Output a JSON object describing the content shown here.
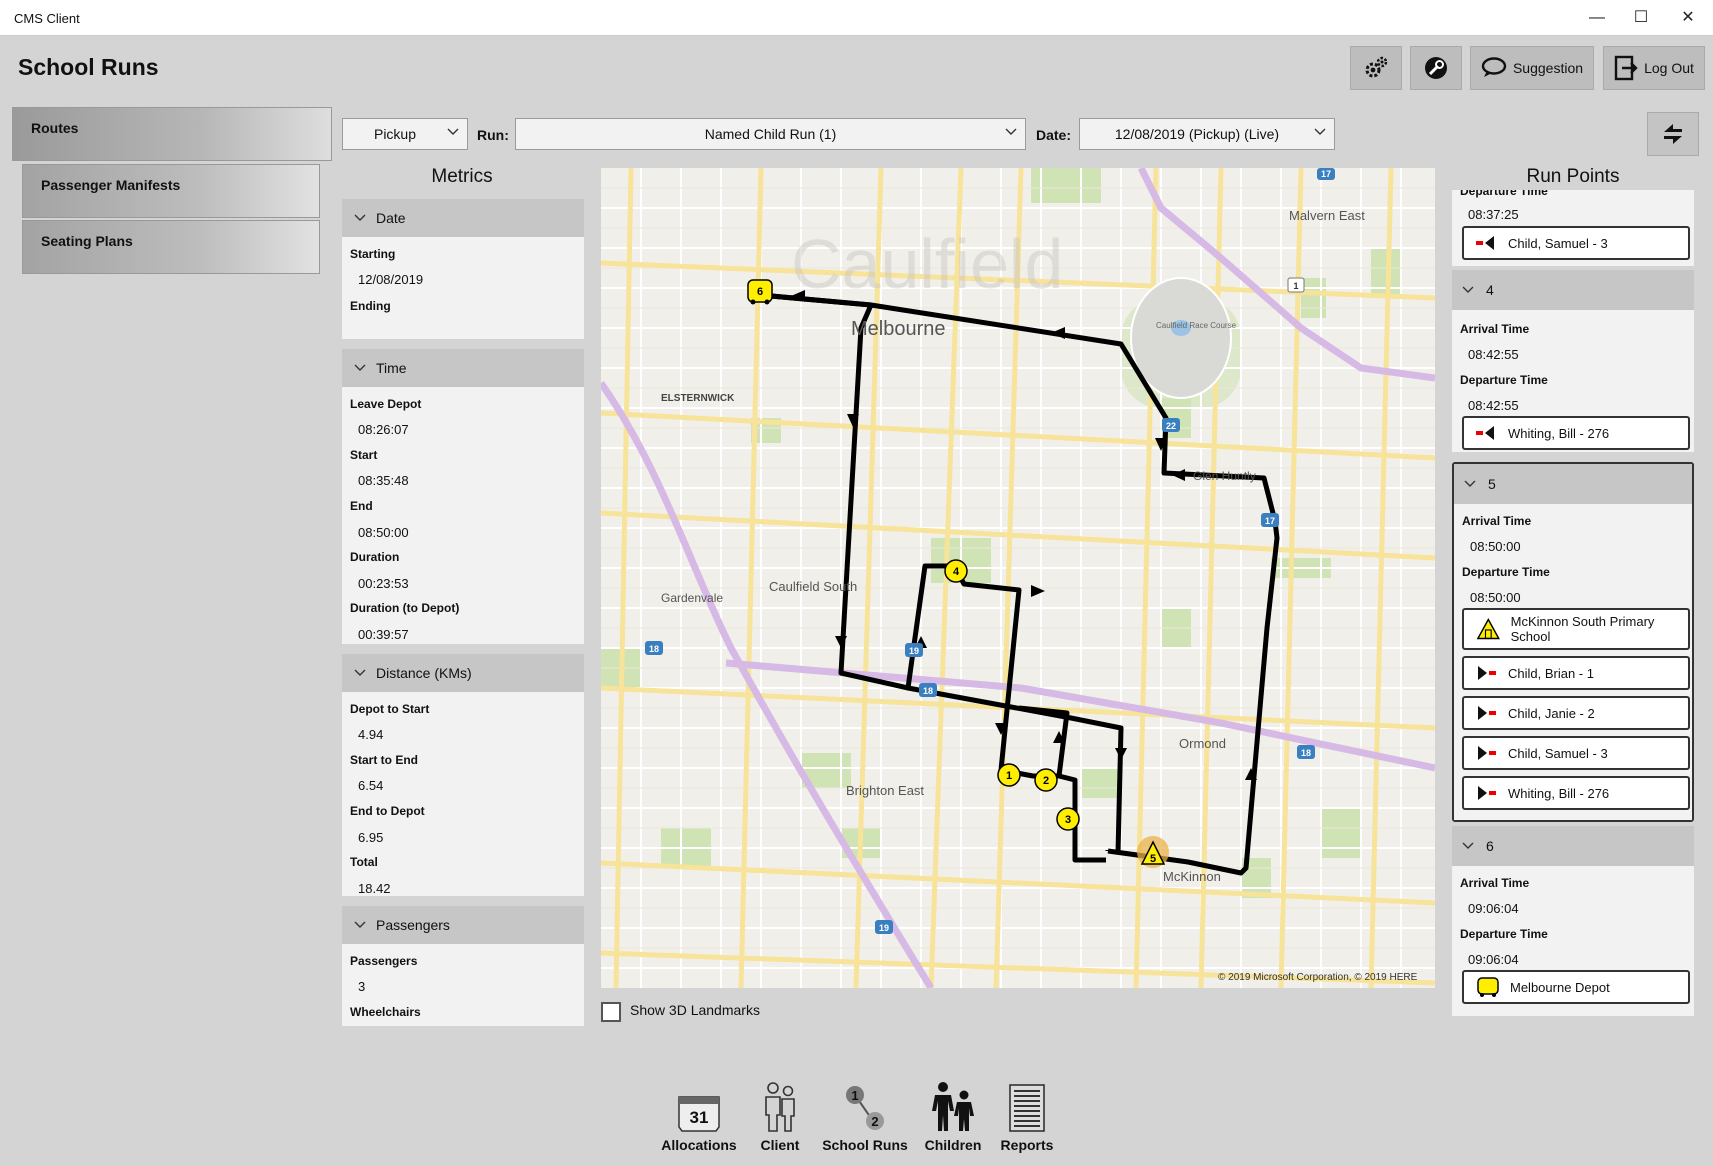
{
  "window": {
    "title": "CMS Client",
    "minimize": "—",
    "maximize": "☐",
    "close": "✕"
  },
  "app": {
    "title": "School Runs"
  },
  "toolbar": {
    "settings_icon": "gears-icon",
    "support_icon": "wrench-icon",
    "suggestion_label": "Suggestion",
    "logout_label": "Log Out"
  },
  "nav": {
    "items": [
      {
        "label": "Routes",
        "active": true
      },
      {
        "label": "Passenger Manifests",
        "active": false
      },
      {
        "label": "Seating Plans",
        "active": false
      }
    ]
  },
  "selectors": {
    "type": "Pickup",
    "run_label": "Run:",
    "run": "Named Child Run (1)",
    "date_label": "Date:",
    "date": "12/08/2019 (Pickup) (Live)"
  },
  "metrics": {
    "title": "Metrics",
    "date": {
      "header": "Date",
      "starting_label": "Starting",
      "starting": "12/08/2019",
      "ending_label": "Ending"
    },
    "time": {
      "header": "Time",
      "leave_depot_label": "Leave Depot",
      "leave_depot": "08:26:07",
      "start_label": "Start",
      "start": "08:35:48",
      "end_label": "End",
      "end": "08:50:00",
      "duration_label": "Duration",
      "duration": "00:23:53",
      "duration_depot_label": "Duration (to Depot)",
      "duration_depot": "00:39:57"
    },
    "distance": {
      "header": "Distance (KMs)",
      "depot_to_start_label": "Depot to Start",
      "depot_to_start": "4.94",
      "start_to_end_label": "Start to End",
      "start_to_end": "6.54",
      "end_to_depot_label": "End to Depot",
      "end_to_depot": "6.95",
      "total_label": "Total",
      "total": "18.42"
    },
    "passengers": {
      "header": "Passengers",
      "passengers_label": "Passengers",
      "passengers": "3",
      "wheelchairs_label": "Wheelchairs"
    }
  },
  "map": {
    "labels": {
      "suburb_big": "Caulfield",
      "city": "Melbourne",
      "elsternwick": "ELSTERNWICK",
      "malvern_east": "Malvern East",
      "caulfield_south": "Caulfield South",
      "gardenvale": "Gardenvale",
      "brighton_east": "Brighton East",
      "ormond": "Ormond",
      "mckinnon": "McKinnon",
      "glen_huntly": "Glen Huntly",
      "race_course": "Caulfield Race Course"
    },
    "copyright": "© 2019 Microsoft Corporation, © 2019 HERE",
    "stops": [
      "1",
      "2",
      "3",
      "4",
      "5",
      "6"
    ],
    "route_color": "#000000",
    "marker_color": "#ffee00"
  },
  "show_3d": {
    "label": "Show 3D Landmarks",
    "checked": false
  },
  "run_points": {
    "title": "Run Points",
    "partial": {
      "departure_label": "Departure Time",
      "departure": "08:37:25",
      "passenger": "Child, Samuel - 3"
    },
    "point4": {
      "header": "4",
      "arrival_label": "Arrival Time",
      "arrival": "08:42:55",
      "departure_label": "Departure Time",
      "departure": "08:42:55",
      "passenger": "Whiting, Bill - 276"
    },
    "point5": {
      "header": "5",
      "arrival_label": "Arrival Time",
      "arrival": "08:50:00",
      "departure_label": "Departure Time",
      "departure": "08:50:00",
      "school": "McKinnon South Primary School",
      "passengers": [
        "Child, Brian - 1",
        "Child, Janie - 2",
        "Child, Samuel - 3",
        "Whiting, Bill - 276"
      ]
    },
    "point6": {
      "header": "6",
      "arrival_label": "Arrival Time",
      "arrival": "09:06:04",
      "departure_label": "Departure Time",
      "departure": "09:06:04",
      "depot": "Melbourne Depot"
    }
  },
  "bottom_nav": {
    "allocations": "Allocations",
    "calendar_day": "31",
    "client": "Client",
    "school_runs": "School Runs",
    "run_a": "1",
    "run_b": "2",
    "children": "Children",
    "reports": "Reports"
  }
}
